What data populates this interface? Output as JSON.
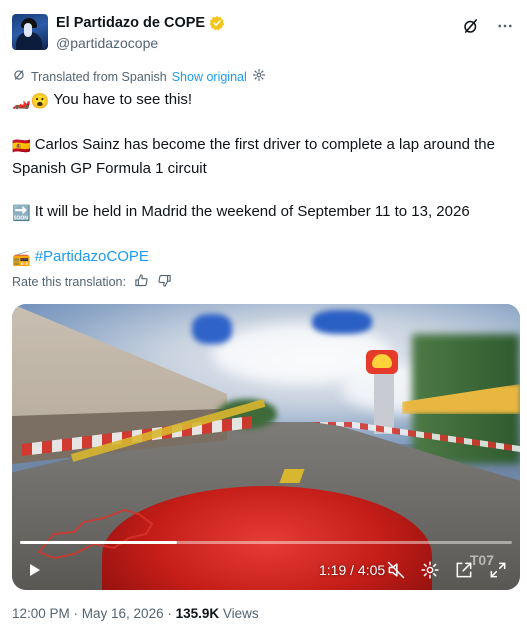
{
  "post": {
    "author": {
      "display_name": "El Partidazo de COPE",
      "handle": "@partidazocope"
    },
    "translation": {
      "label": "Translated from Spanish",
      "show_original": "Show original",
      "rate_label": "Rate this translation:"
    },
    "lines": [
      {
        "emoji": "🏎️😮",
        "text": "You have to see this!"
      },
      {
        "emoji": "🇪🇸",
        "text": "Carlos Sainz has become the first driver to complete a lap around the Spanish GP Formula 1 circuit"
      },
      {
        "emoji": "🔜",
        "text": "It will be held in Madrid the weekend of September 11 to 13, 2026"
      },
      {
        "emoji": "📻",
        "text": "#PartidazoCOPE"
      }
    ],
    "video": {
      "time_display": "1:19 / 4:05",
      "progress": 0.32,
      "overlay_text": "T07"
    },
    "footer": {
      "timestamp": "12:00 PM · May 16, 2026 · ",
      "views_count": "135.9K",
      "views_label": " Views"
    }
  },
  "colors": {
    "link": "#1d9bf0",
    "secondary_text": "#536471",
    "verified": "#f4c51c"
  },
  "icons": {
    "verified": "gold-verified-badge",
    "grok": "slash-circle-icon",
    "more": "more-horizontal-icon",
    "translate": "translate-icon",
    "settings": "settings-icon",
    "thumbs_up": "thumbs-up-icon",
    "thumbs_down": "thumbs-down-icon",
    "play": "play-icon",
    "mute": "mute-icon",
    "gear": "gear-icon",
    "popout": "popout-icon",
    "fullscreen": "fullscreen-icon"
  }
}
